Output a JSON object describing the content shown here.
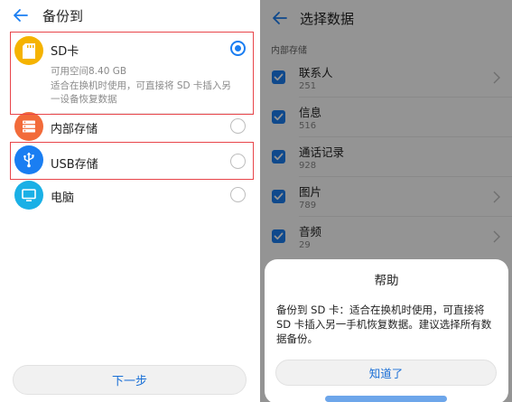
{
  "left": {
    "title": "备份到",
    "options": [
      {
        "label": "SD卡",
        "selected": true,
        "sub_lines": [
          "可用空间8.40 GB",
          "适合在换机时使用，可直接将 SD 卡插入另",
          "一设备恢复数据"
        ],
        "icon": "sd-card-icon",
        "color": "#f5b300"
      },
      {
        "label": "内部存储",
        "selected": false,
        "icon": "storage-icon",
        "color": "#f26b3a"
      },
      {
        "label": "USB存储",
        "selected": false,
        "icon": "usb-icon",
        "color": "#1a7ef2"
      },
      {
        "label": "电脑",
        "selected": false,
        "icon": "computer-icon",
        "color": "#1ab0e6"
      }
    ],
    "next_button": "下一步"
  },
  "right": {
    "title": "选择数据",
    "section_label": "内部存储",
    "items": [
      {
        "label": "联系人",
        "count": "251",
        "checked": true,
        "has_chevron": true
      },
      {
        "label": "信息",
        "count": "516",
        "checked": true,
        "has_chevron": false
      },
      {
        "label": "通话记录",
        "count": "928",
        "checked": true,
        "has_chevron": false
      },
      {
        "label": "图片",
        "count": "789",
        "checked": true,
        "has_chevron": true
      },
      {
        "label": "音频",
        "count": "29",
        "checked": true,
        "has_chevron": true
      }
    ],
    "dialog": {
      "title": "帮助",
      "body": "备份到 SD 卡：适合在换机时使用，可直接将 SD 卡插入另一手机恢复数据。建议选择所有数据备份。",
      "button": "知道了"
    }
  },
  "colors": {
    "accent": "#1a7ef2",
    "highlight": "#e8454a"
  }
}
